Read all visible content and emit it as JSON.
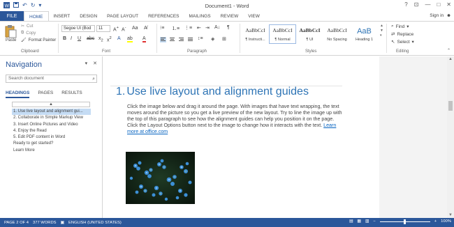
{
  "app": {
    "window_title": "Document1 - Word",
    "signin": "Sign in"
  },
  "tabs": {
    "file": "FILE",
    "items": [
      "HOME",
      "INSERT",
      "DESIGN",
      "PAGE LAYOUT",
      "REFERENCES",
      "MAILINGS",
      "REVIEW",
      "VIEW"
    ],
    "active": "HOME"
  },
  "ribbon": {
    "clipboard": {
      "paste": "Paste",
      "cut": "Cut",
      "copy": "Copy",
      "format_painter": "Format Painter",
      "label": "Clipboard"
    },
    "font": {
      "font_name": "Segoe UI (Bod",
      "font_size": "11",
      "label": "Font"
    },
    "paragraph": {
      "label": "Paragraph"
    },
    "styles": {
      "items": [
        {
          "sample": "AaBbCcI",
          "name": "¶ Instructi..."
        },
        {
          "sample": "AaBbCcI",
          "name": "¶ Normal"
        },
        {
          "sample": "AaBbCcI",
          "name": "¶ UI"
        },
        {
          "sample": "AaBbCcI",
          "name": "No Spacing"
        },
        {
          "sample": "AaB",
          "name": "Heading 1"
        }
      ],
      "label": "Styles"
    },
    "editing": {
      "find": "Find",
      "replace": "Replace",
      "select": "Select",
      "label": "Editing"
    }
  },
  "nav": {
    "title": "Navigation",
    "search_placeholder": "Search document",
    "tabs": [
      "HEADINGS",
      "PAGES",
      "RESULTS"
    ],
    "collapse": "▲",
    "items": [
      "1. Use live layout and alignment gui...",
      "2. Collaborate in Simple Markup View",
      "3. Insert Online Pictures and Video",
      "4. Enjoy the Read",
      "5. Edit PDF content in Word",
      "Ready to get started?",
      "Learn More"
    ]
  },
  "document": {
    "heading_num": "1.",
    "heading": "Use live layout and alignment guides",
    "paragraph": "Click the image below and drag it around the page. With images that have text wrapping, the text moves around the picture so you get a live preview of the new layout. Try to line the image up with the top of this paragraph to see how the alignment guides can help you position it on the page.  Click the Layout Options button next to the image to change how it interacts with the text.",
    "link": "Learn more at office.com"
  },
  "status": {
    "page": "PAGE 2 OF 4",
    "words": "377 WORDS",
    "language": "ENGLISH (UNITED STATES)",
    "zoom": "100%"
  },
  "colors": {
    "accent": "#2b579a",
    "heading": "#2e74b5",
    "link": "#0563c1"
  }
}
